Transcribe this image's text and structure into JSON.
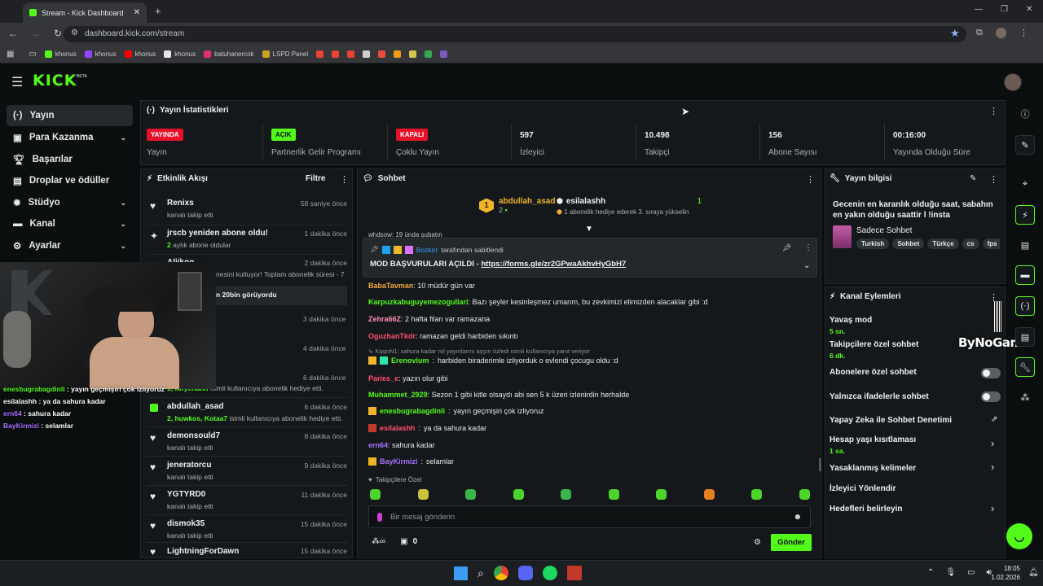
{
  "browser": {
    "tab_title": "Stream - Kick Dashboard",
    "url": "dashboard.kick.com/stream",
    "bookmarks": [
      "khonus",
      "khonus",
      "khonus",
      "khonus",
      "batuhanercok",
      "LSPD Panel"
    ]
  },
  "brand": {
    "logo": "KICK",
    "beta": "BETA",
    "accent": "#53fc18"
  },
  "sidebar": {
    "items": [
      {
        "label": "Yayın",
        "icon": "broadcast-icon"
      },
      {
        "label": "Para Kazanma",
        "icon": "wallet-icon"
      },
      {
        "label": "Başarılar",
        "icon": "trophy-icon"
      },
      {
        "label": "Droplar ve ödüller",
        "icon": "gift-icon"
      },
      {
        "label": "Stüdyo",
        "icon": "gear-icon"
      },
      {
        "label": "Kanal",
        "icon": "channel-icon"
      },
      {
        "label": "Ayarlar",
        "icon": "gear-icon"
      }
    ]
  },
  "stats": {
    "title": "Yayın İstatistikleri",
    "cards": [
      {
        "badge": "YAYINDA",
        "label": "Yayın"
      },
      {
        "badge": "AÇIK",
        "label": "Partnerlik Gelir Programı"
      },
      {
        "badge": "KAPALI",
        "label": "Çoklu Yayın"
      },
      {
        "value": "597",
        "label": "İzleyici"
      },
      {
        "value": "10.498",
        "label": "Takipçi"
      },
      {
        "value": "156",
        "label": "Abone Sayısı"
      },
      {
        "value": "00:16:00",
        "label": "Yayında Olduğu Süre"
      }
    ]
  },
  "feed": {
    "title": "Etkinlik Akışı",
    "filter": "Filtre",
    "items": [
      {
        "name": "Renixs",
        "sub": "kanalı takip etti",
        "time": "58 saniye önce"
      },
      {
        "name": "jrscb yeniden abone oldu!",
        "sub_hl": "2",
        "sub": "aylık abone oldular",
        "time": "1 dakika önce"
      },
      {
        "name": "Alijkoo",
        "sub": "nesini kutluyor! Toplam abonelik süresi - 7",
        "time": "2 dakika önce"
      },
      {
        "name": "",
        "sub": "n 20bin görüyordu",
        "time": ""
      },
      {
        "name": "",
        "sub": "",
        "time": "3 dakika önce"
      },
      {
        "name": "",
        "sub": "",
        "time": "4 dakika önce"
      },
      {
        "name": "",
        "sub": "",
        "time": "6 dakika önce"
      },
      {
        "name": "abdullah_asad",
        "sub_hl": "2, huwkos, Kotaa7",
        "sub": "isimli kullanıcıya abonelik hediye etti.",
        "time": "6 dakika önce"
      },
      {
        "name": "demonsould7",
        "sub": "kanalı takip etti",
        "time": "8 dakika önce"
      },
      {
        "name": "jeneratorcu",
        "sub": "kanalı takip etti",
        "time": "9 dakika önce"
      },
      {
        "name": "YGTYRD0",
        "sub": "kanalı takip etti",
        "time": "11 dakika önce"
      },
      {
        "name": "dismok35",
        "sub": "kanalı takip etti",
        "time": "15 dakika önce"
      },
      {
        "name": "LightningForDawn",
        "sub": "",
        "time": "15 dakika önce"
      }
    ],
    "partial_gift": {
      "hl": "1, furychann",
      "text": "isimli kullanıcıya abonelik hediye etti."
    }
  },
  "chat": {
    "title": "Sohbet",
    "top_gifter": {
      "rank": "1",
      "name": "abdullah_asad",
      "count": "2"
    },
    "recent": {
      "name": "esilalashh",
      "count": "1",
      "note": "1 abonelik hediye ederek 3. sıraya yükselin"
    },
    "cut_line": "whdsow: 19 ünda şubatın",
    "pinned_by": "Bozkirr",
    "pinned_by_suffix": "tarafından sabitlendi",
    "pinned_text": "MOD BAŞVURULARI AÇILDI - ",
    "pinned_link": "https://forms.gle/zr2GPwaAkhvHyGbH7",
    "messages": [
      {
        "user": "BabaTavman",
        "color": "#f0a93d",
        "text": "10 müdür gün var"
      },
      {
        "user": "Karpuzkabuguyemezogullari",
        "color": "#53fc18",
        "text": "Bazı şeyler kesinleşmez umarım, bu zevkimizi elimizden alacaklar gibi :d"
      },
      {
        "user": "Zehra66Z",
        "color": "#ff8fb1",
        "text": "2 hafta filan var ramazana"
      },
      {
        "user": "OguzhanTkdr",
        "color": "#ff4d6d",
        "text": "ramazan geldi harbiden sıkıntı"
      },
      {
        "user": "Erenovium",
        "color": "#53fc18",
        "text": "harbiden biraderimle izliyorduk o evlendi çocugu oldu :d"
      },
      {
        "user": "Paries_e",
        "color": "#ff4d6d",
        "text": "yazın olur gibi"
      },
      {
        "user": "Muhammet_2929",
        "color": "#53fc18",
        "text": "Sezon 1 gibi kitle olsaydı abi sen 5 k üzeri izlenirdin herhalde"
      },
      {
        "user": "enesbugrabagdinli",
        "color": "#53fc18",
        "text": "yayın geçmişiri çok izliyoruz"
      },
      {
        "user": "esilalashh",
        "color": "#ff4d6d",
        "text": "ya da sahura kadar"
      },
      {
        "user": "ern64",
        "color": "#a970ff",
        "text": "sahura kadar"
      },
      {
        "user": "BayKirmizi",
        "color": "#a970ff",
        "text": "selamlar"
      }
    ],
    "reply_hint": "KqqnN1: sahura kadar rol yayınlarını aşşırı özledi isimli kullanıcıya yanıt veriyor",
    "followers_only": "Takipçilere Özel",
    "input_placeholder": "Bir mesaj gönderin",
    "points": "0",
    "send": "Gönder"
  },
  "stream_info": {
    "title": "Yayın bilgisi",
    "stream_title": "Gecenin en karanlık olduğu saat, sabahın en yakın olduğu saattir l !insta",
    "category": "Sadece Sohbet",
    "tags": [
      "Turkish",
      "Sohbet",
      "Türkçe",
      "cs",
      "fps"
    ]
  },
  "channel_actions": {
    "title": "Kanal Eylemleri",
    "items": [
      {
        "label": "Yavaş mod",
        "value": "5 sn."
      },
      {
        "label": "Takipçilere özel sohbet",
        "value": "6 dk."
      },
      {
        "label": "Abonelere özel sohbet",
        "value": ""
      },
      {
        "label": "Yalnızca ifadelerle sohbet",
        "value": ""
      },
      {
        "label": "Yapay Zeka ile Sohbet Denetimi",
        "value": ""
      },
      {
        "label": "Hesap yaşı kısıtlaması",
        "value": "1 sa."
      },
      {
        "label": "Yasaklanmış kelimeler",
        "value": ""
      },
      {
        "label": "İzleyici Yönlendir",
        "value": ""
      },
      {
        "label": "Hedefleri belirleyin",
        "value": ""
      }
    ]
  },
  "overlay": {
    "watermark": "ByNoGame",
    "chat": [
      {
        "user": "enesbugrabagdinli",
        "color": "#53fc18",
        "text": "yayın geçmişiri çok izliyoruz"
      },
      {
        "user": "esilalashh",
        "color": "#ffffff",
        "text": "ya da sahura kadar"
      },
      {
        "user": "ern64",
        "color": "#a970ff",
        "text": "sahura kadar"
      },
      {
        "user": "BayKirmizi",
        "color": "#a970ff",
        "text": "selamlar"
      }
    ]
  },
  "taskbar": {
    "time": "18:05",
    "date": "1.02.2026"
  }
}
